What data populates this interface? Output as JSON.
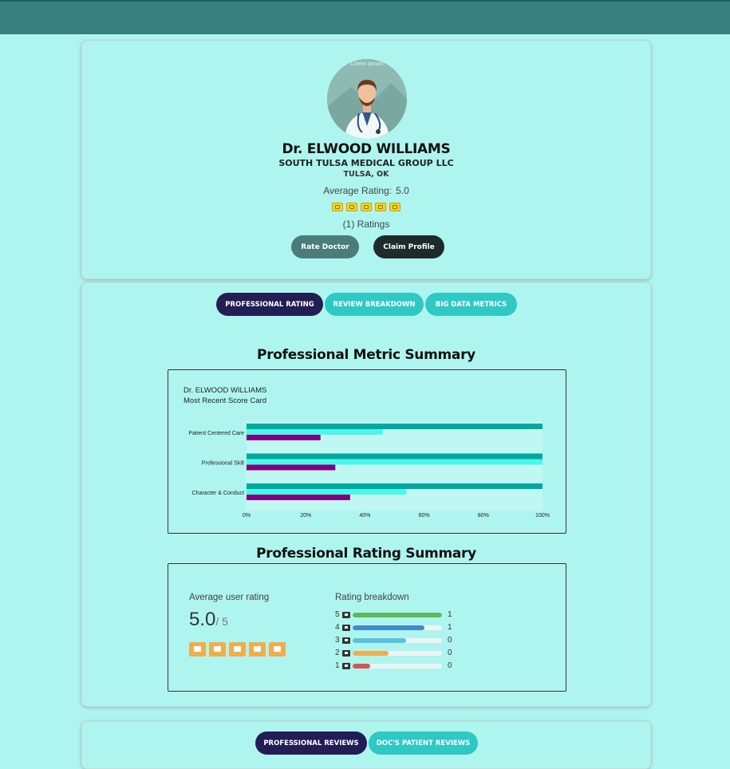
{
  "profile": {
    "name": "Dr. ELWOOD WILLIAMS",
    "organization": "SOUTH TULSA MEDICAL GROUP LLC",
    "location": "TULSA, OK",
    "avg_rating_label": "Average Rating:",
    "avg_rating_value": "5.0",
    "star_count": 5,
    "ratings_count": "(1) Ratings",
    "rate_button": "Rate Doctor",
    "claim_button": "Claim Profile",
    "avatar_text": "Lorem ipsum"
  },
  "metric_tabs": [
    "PROFESSIONAL RATING",
    "REVIEW BREAKDOWN",
    "BIG DATA METRICS"
  ],
  "metric_summary": {
    "title": "Professional Metric Summary",
    "chart_header_name": "Dr. ELWOOD WILLIAMS",
    "chart_header_sub": "Most Recent Score Card"
  },
  "chart_data": {
    "type": "bar",
    "orientation": "horizontal",
    "categories": [
      "Patient Centered Care",
      "Professional Skill",
      "Character & Conduct"
    ],
    "series": [
      {
        "values": [
          100,
          100,
          100
        ],
        "color": "#00a99d"
      },
      {
        "values": [
          46,
          100,
          54
        ],
        "color": "#4ef5ea"
      },
      {
        "values": [
          25,
          30,
          35
        ],
        "color": "#800080"
      }
    ],
    "xlim": [
      0,
      100
    ],
    "x_ticks": [
      "0%",
      "20%",
      "40%",
      "60%",
      "80%",
      "100%"
    ],
    "grid": false
  },
  "rating_summary": {
    "title": "Professional Rating Summary",
    "avg_label": "Average user rating",
    "avg_value": "5.0",
    "avg_of": "/ 5",
    "icon_count": 5,
    "breakdown_label": "Rating breakdown",
    "rows": [
      {
        "star": "5",
        "count": "1",
        "fill": 1.0,
        "color": "#5cb85c"
      },
      {
        "star": "4",
        "count": "1",
        "fill": 0.8,
        "color": "#428bca"
      },
      {
        "star": "3",
        "count": "0",
        "fill": 0.6,
        "color": "#5bc0de"
      },
      {
        "star": "2",
        "count": "0",
        "fill": 0.4,
        "color": "#f0ad4e"
      },
      {
        "star": "1",
        "count": "0",
        "fill": 0.2,
        "color": "#d9534f"
      }
    ]
  },
  "review_tabs": [
    "PROFESSIONAL REVIEWS",
    "DOC'S PATIENT REVIEWS"
  ]
}
